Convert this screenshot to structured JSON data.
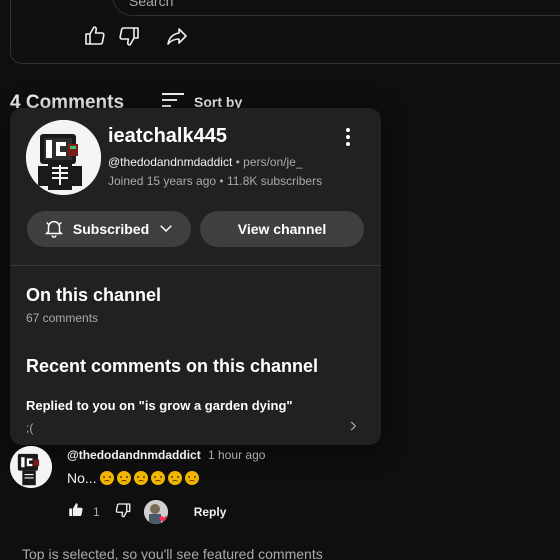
{
  "top": {
    "search_placeholder": "Search"
  },
  "comments_header": {
    "count_label": "4 Comments",
    "sort_label": "Sort by"
  },
  "popup": {
    "channel_name": "ieatchalk445",
    "handle": "@thedodandnmdaddict",
    "handle_extra": "• pers/on/je_",
    "meta": "Joined 15 years ago • 11.8K subscribers",
    "subscribed_label": "Subscribed",
    "view_channel_label": "View channel",
    "on_channel_title": "On this channel",
    "on_channel_count": "67 comments",
    "recent_title": "Recent comments on this channel",
    "replied_text": "Replied to you on \"is grow a garden dying\"",
    "reply_snippet": ";("
  },
  "comment": {
    "author": "@thedodandnmdaddict",
    "time": "1 hour ago",
    "text": "No...",
    "emoji_count": 6,
    "likes": "1",
    "reply_label": "Reply"
  },
  "footer": {
    "note": "Top is selected, so you'll see featured comments"
  },
  "icons": [
    "like-icon",
    "dislike-icon",
    "share-icon",
    "sort-icon",
    "more-vert-icon",
    "bell-icon",
    "chevron-down-icon",
    "chevron-right-icon",
    "heart-icon"
  ],
  "colors": {
    "background": "#0f0f0f",
    "card": "#212121",
    "button": "#3f3f3f",
    "heart": "#ff2d55"
  }
}
